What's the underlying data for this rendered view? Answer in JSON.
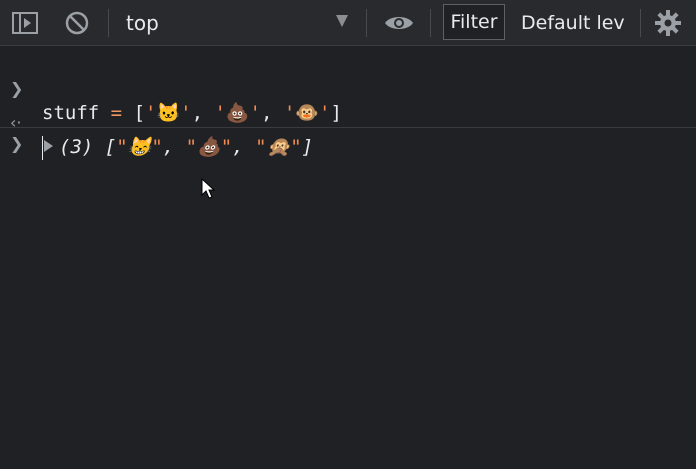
{
  "toolbar": {
    "context": "top",
    "filter_placeholder": "Filter",
    "levels_label": "Default lev"
  },
  "console": {
    "input_line": {
      "var": "stuff",
      "op": "=",
      "open": "[",
      "items": [
        "'🐱'",
        "'💩'",
        "'🐵'"
      ],
      "sep": ", ",
      "close": "]"
    },
    "output_line": {
      "count": "(3)",
      "open": "[",
      "items": [
        "\"😸\"",
        "\"💩\"",
        "\"🙊\""
      ],
      "sep": ", ",
      "close": "]"
    }
  },
  "colors": {
    "background": "#202124",
    "toolbar": "#292a2d",
    "string": "#f28b54",
    "text": "#e8eaed"
  }
}
